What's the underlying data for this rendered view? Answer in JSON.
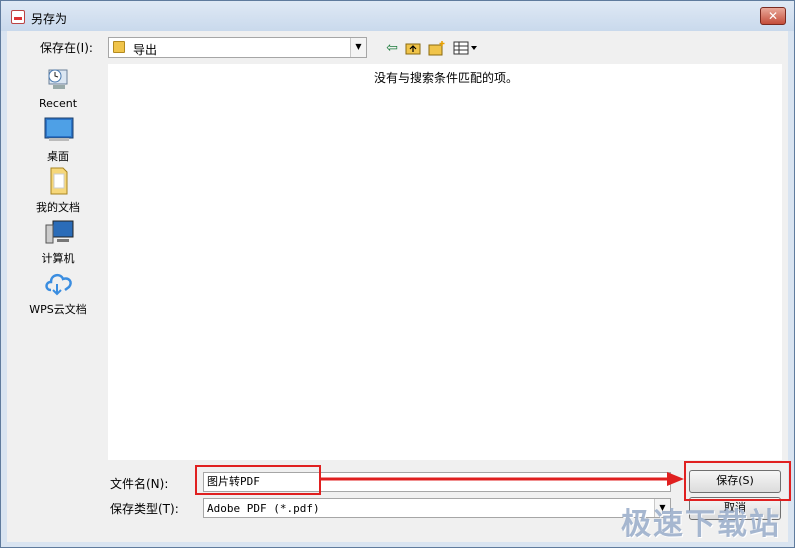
{
  "window": {
    "title": "另存为",
    "close_label": "✕"
  },
  "toolbar": {
    "location_label": "保存在(I):",
    "location_value": "导出",
    "icons": [
      "back-icon",
      "up-folder-icon",
      "new-folder-icon",
      "view-menu-icon"
    ]
  },
  "places": [
    {
      "label": "Recent",
      "icon": "recent-icon"
    },
    {
      "label": "桌面",
      "icon": "desktop-icon"
    },
    {
      "label": "我的文档",
      "icon": "documents-icon"
    },
    {
      "label": "计算机",
      "icon": "computer-icon"
    },
    {
      "label": "WPS云文档",
      "icon": "cloud-icon"
    }
  ],
  "filelist": {
    "empty_message": "没有与搜索条件匹配的项。"
  },
  "form": {
    "filename_label": "文件名(N):",
    "filename_value": "图片转PDF",
    "filetype_label": "保存类型(T):",
    "filetype_value": "Adobe PDF (*.pdf)",
    "save_button": "保存(S)",
    "cancel_button": "取消"
  },
  "watermark": "极速下载站",
  "colors": {
    "highlight": "#e02020",
    "window_frame": "#d9e4f1"
  }
}
